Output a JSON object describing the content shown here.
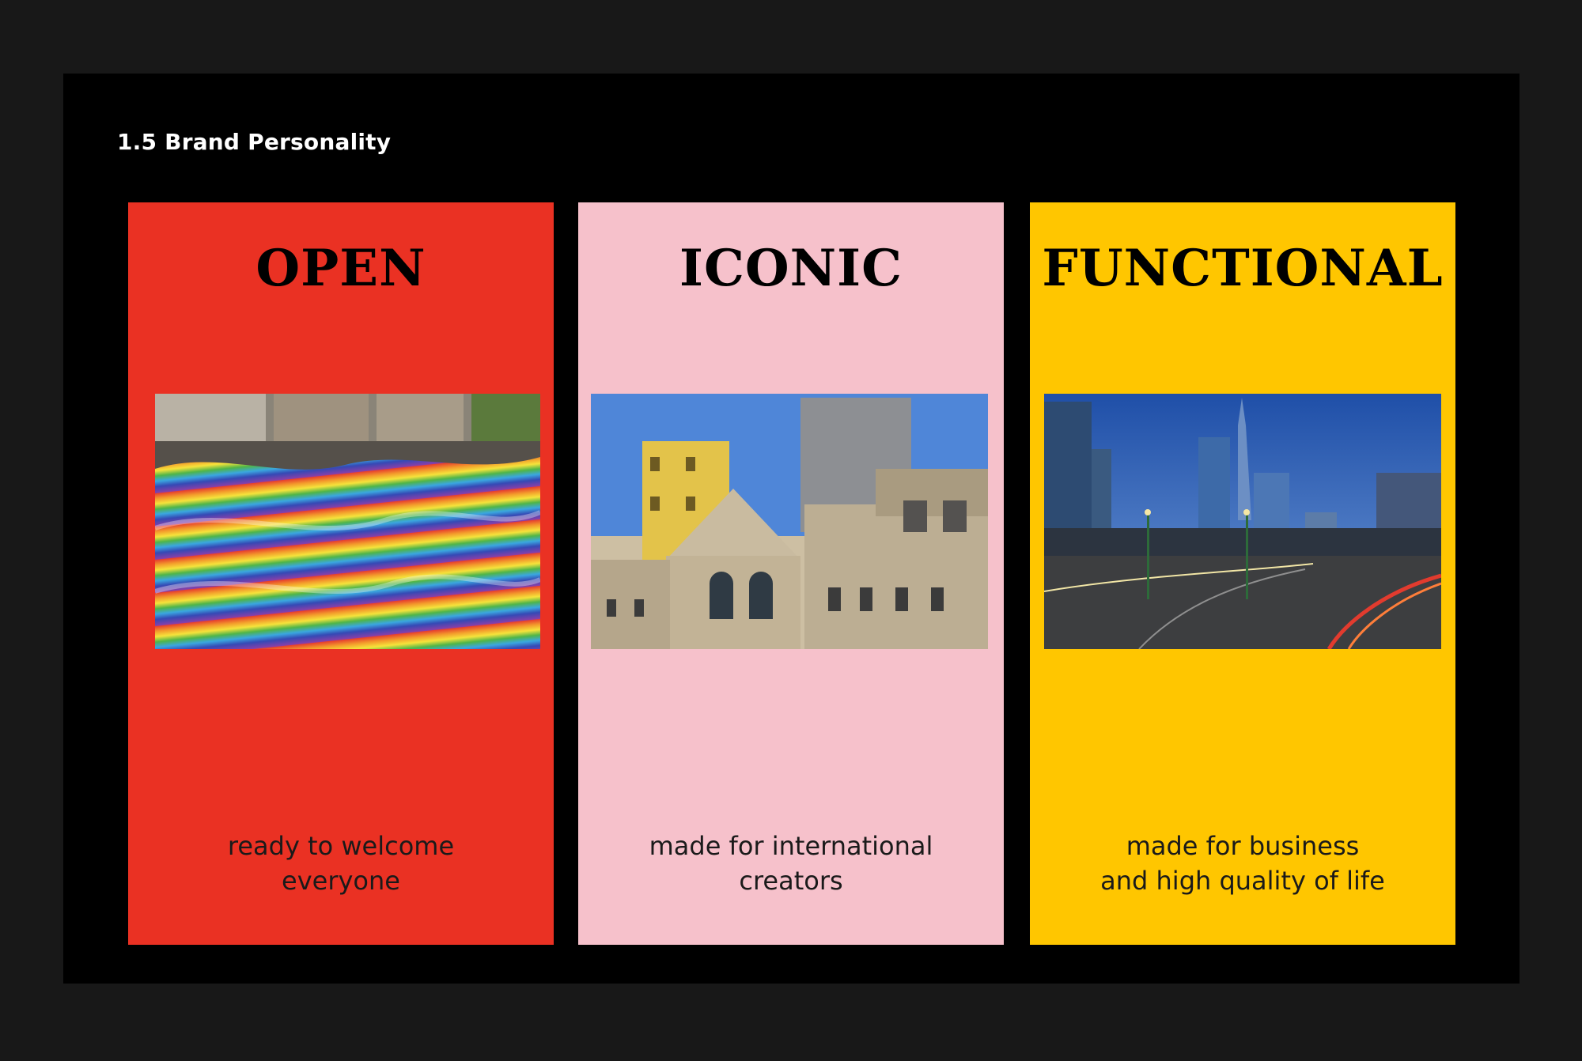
{
  "page": {
    "section_title": "1.5 Brand Personality",
    "background": "#181818",
    "slide_background": "#000000"
  },
  "cards": [
    {
      "heading": "OPEN",
      "caption_lines": [
        "ready to welcome",
        "everyone"
      ],
      "background": "#ea3123",
      "photo": "rainbow-striped-fabric-crowd-photo"
    },
    {
      "heading": "ICONIC",
      "caption_lines": [
        "made for international",
        "creators"
      ],
      "background": "#f6c1cb",
      "photo": "gold-tower-historic-building-photo"
    },
    {
      "heading": "FUNCTIONAL",
      "caption_lines": [
        "made for business",
        "and high quality of life"
      ],
      "background": "#ffc600",
      "photo": "city-skyline-night-traffic-photo"
    }
  ]
}
